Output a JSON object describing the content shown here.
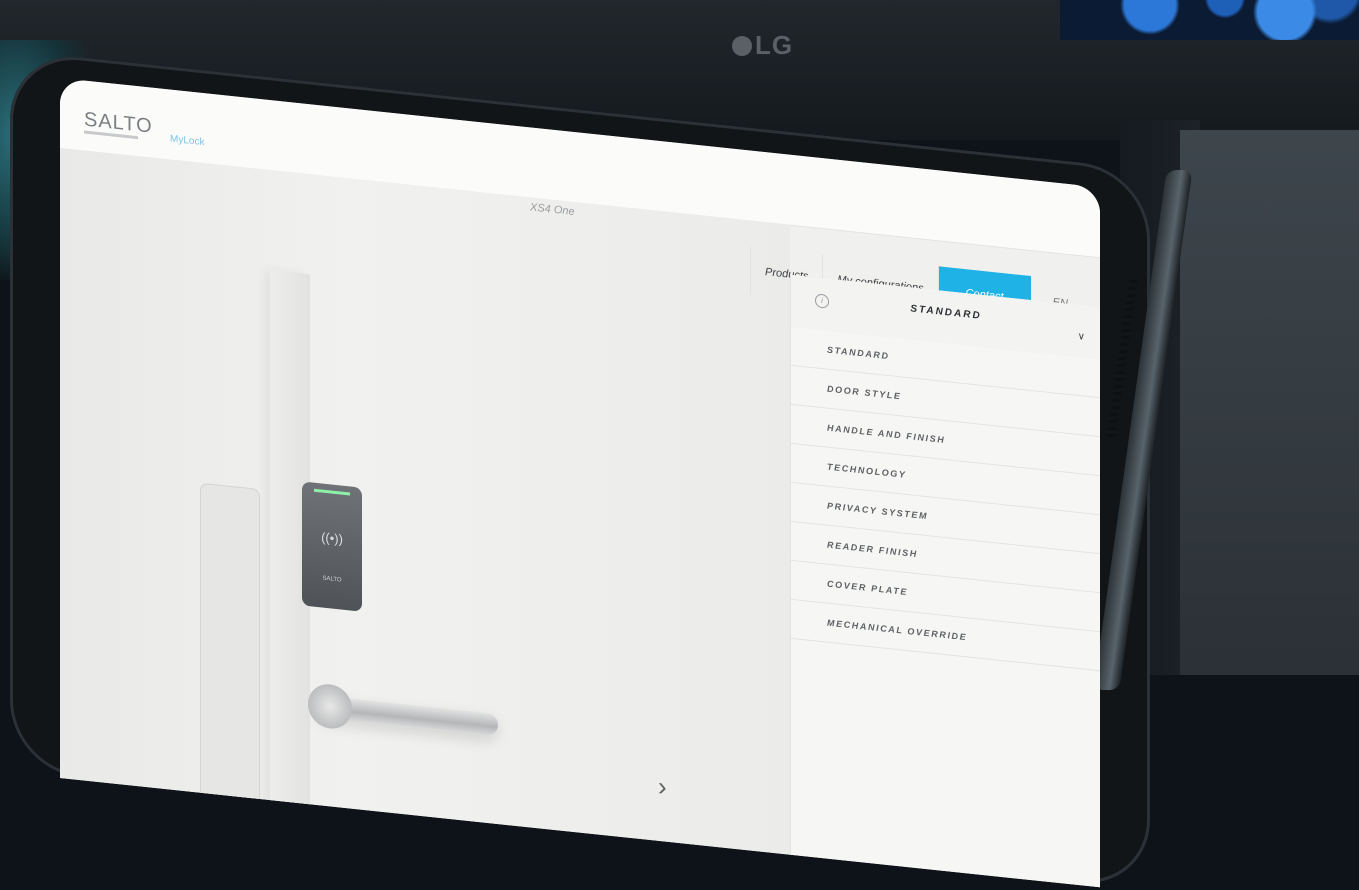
{
  "monitor": {
    "brand": "LG"
  },
  "app": {
    "logo": "SALTO",
    "mylock_label": "MyLock",
    "product_name": "XS4 One"
  },
  "nav": {
    "products": "Products",
    "my_configurations": "My configurations",
    "contact": "Contact",
    "language": "EN"
  },
  "reader": {
    "brand": "SALTO",
    "icon": "((•))"
  },
  "panel": {
    "selected": "STANDARD",
    "options": [
      "STANDARD",
      "DOOR STYLE",
      "HANDLE AND FINISH",
      "TECHNOLOGY",
      "PRIVACY SYSTEM",
      "READER FINISH",
      "COVER PLATE",
      "MECHANICAL OVERRIDE"
    ]
  },
  "colors": {
    "accent": "#1fb2e6",
    "led": "#8ff0a8"
  }
}
